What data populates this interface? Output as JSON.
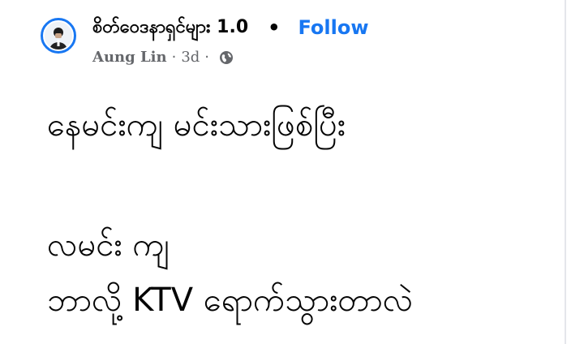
{
  "post": {
    "group_name": "စိတ်ဝေဒနာရှင်များ 1.0",
    "separator": "•",
    "follow_label": "Follow",
    "author": "Aung Lin",
    "meta_sep1": "·",
    "time": "3d",
    "meta_sep2": "·",
    "privacy_icon": "globe-icon",
    "lines": [
      "နေမင်းကျ မင်းသားဖြစ်ပြီး",
      "လမင်း ကျ",
      "ဘာလို့ KTV ရောက်သွားတာလဲ"
    ]
  },
  "colors": {
    "accent": "#1877f2",
    "text": "#050505",
    "meta": "#65676b"
  }
}
